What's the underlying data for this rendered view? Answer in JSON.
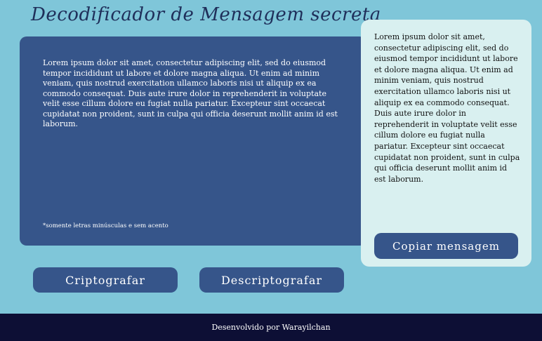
{
  "header": {
    "title": "Decodificador de Mensagem secreta"
  },
  "input": {
    "text": "Lorem ipsum dolor sit amet, consectetur adipiscing elit, sed do eiusmod tempor incididunt ut labore et dolore magna aliqua. Ut enim ad minim veniam, quis nostrud exercitation ullamco laboris nisi ut aliquip ex ea commodo consequat. Duis aute irure dolor in reprehenderit in voluptate velit esse cillum dolore eu fugiat nulla pariatur. Excepteur sint occaecat cupidatat non proident, sunt in culpa qui officia deserunt mollit anim id est laborum.",
    "hint": "*somente letras minúsculas e sem acento"
  },
  "output": {
    "text": "Lorem ipsum dolor sit amet, consectetur adipiscing elit, sed do eiusmod tempor incididunt ut labore et dolore magna aliqua. Ut enim ad minim veniam, quis nostrud exercitation ullamco laboris nisi ut aliquip ex ea commodo consequat. Duis aute irure dolor in reprehenderit in voluptate velit esse cillum dolore eu fugiat nulla pariatur. Excepteur sint occaecat cupidatat non proident, sunt in culpa qui officia deserunt mollit anim id est laborum.",
    "copy_label": "Copiar mensagem"
  },
  "actions": {
    "encrypt_label": "Criptografar",
    "decrypt_label": "Descriptografar"
  },
  "footer": {
    "text": "Desenvolvido por Warayilchan"
  },
  "colors": {
    "background": "#7fc6d9",
    "panel": "#36558a",
    "output_panel": "#d9f0f0",
    "footer": "#0d0f35"
  }
}
